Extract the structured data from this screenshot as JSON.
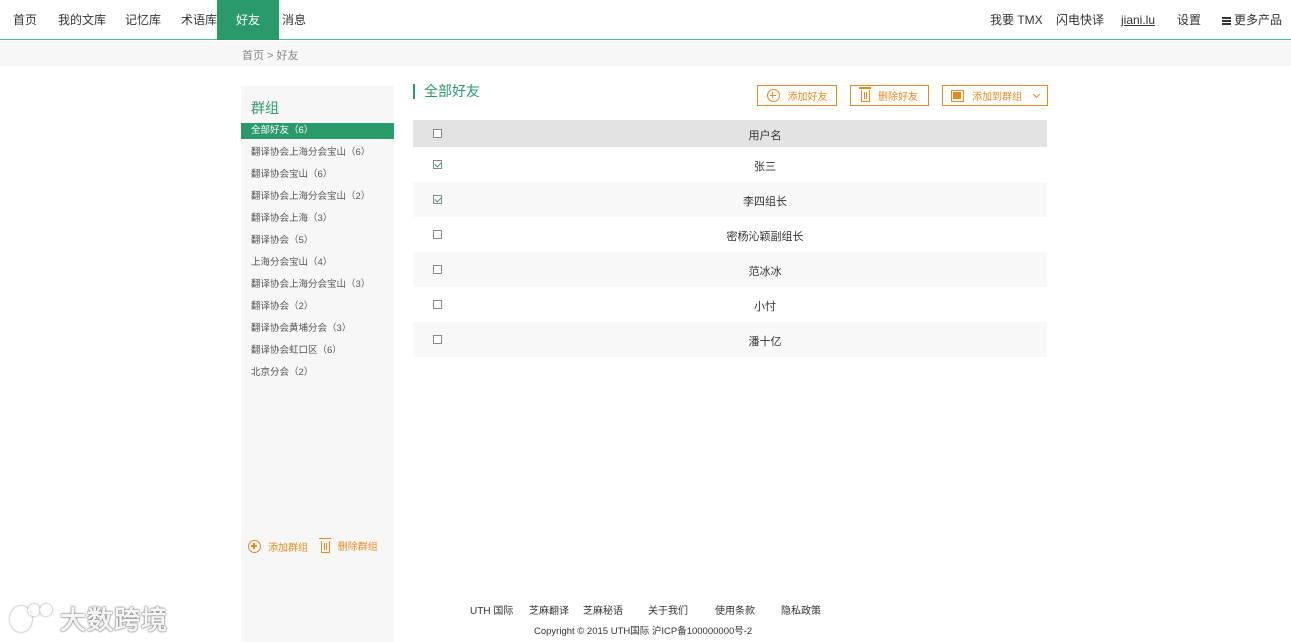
{
  "nav": {
    "left": [
      {
        "label": "首页"
      },
      {
        "label": "我的文库"
      },
      {
        "label": "记忆库"
      },
      {
        "label": "术语库"
      },
      {
        "label": "好友",
        "active": true
      },
      {
        "label": "消息"
      }
    ],
    "right": {
      "tmx": "我要 TMX",
      "quick": "闪电快译",
      "user": "jiani.lu",
      "settings": "设置",
      "more": "更多产品"
    }
  },
  "breadcrumb": {
    "home": "首页",
    "sep": " > ",
    "current": "好友"
  },
  "sidebar": {
    "title": "群组",
    "groups": [
      {
        "label": "全部好友（6）",
        "active": true
      },
      {
        "label": "翻译协会上海分会宝山（6）"
      },
      {
        "label": "翻译协会宝山（6）"
      },
      {
        "label": "翻译协会上海分会宝山（2）"
      },
      {
        "label": "翻译协会上海（3）"
      },
      {
        "label": "翻译协会（5）"
      },
      {
        "label": "上海分会宝山（4）"
      },
      {
        "label": "翻译协会上海分会宝山（3）"
      },
      {
        "label": "翻译协会（2）"
      },
      {
        "label": "翻译协会黄埔分会（3）"
      },
      {
        "label": "翻译协会虹口区（6）"
      },
      {
        "label": "北京分会（2）"
      }
    ],
    "add_group": "添加群组",
    "delete_group": "删除群组"
  },
  "main": {
    "title": "全部好友",
    "add_friend": "添加好友",
    "delete_friend": "删除好友",
    "add_to_group": "添加到群组",
    "table": {
      "header": "用户名",
      "rows": [
        {
          "name": "张三",
          "checked": true
        },
        {
          "name": "李四组长",
          "checked": true
        },
        {
          "name": "密杨沁颖副组长",
          "checked": false
        },
        {
          "name": "范冰冰",
          "checked": false
        },
        {
          "name": "小忖",
          "checked": false
        },
        {
          "name": "潘十亿",
          "checked": false
        }
      ]
    }
  },
  "footer": {
    "links": [
      "UTH 国际",
      "芝麻翻译",
      "芝麻秘语",
      "关于我们",
      "使用条款",
      "隐私政策"
    ],
    "copyright": "Copyright © 2015 UTH国际  沪ICP备100000000号-2"
  },
  "watermark": {
    "text": "大数跨境"
  },
  "colors": {
    "accent": "#2b9a6a",
    "action": "#e58a1f"
  }
}
